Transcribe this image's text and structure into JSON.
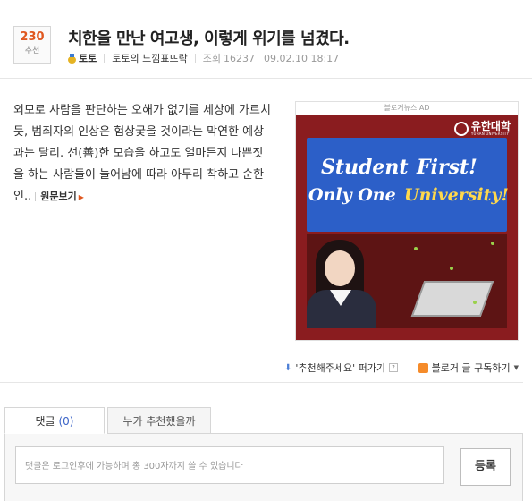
{
  "post": {
    "recommend_count": "230",
    "recommend_label": "추천",
    "title": "치한을 만난 여고생, 이렇게 위기를 넘겼다.",
    "author": "토토",
    "blog_name": "토토의 느낌표뜨락",
    "views_label": "조회",
    "views": "16237",
    "date": "09.02.10 18:17"
  },
  "content": {
    "summary": "외모로 사람을 판단하는 오해가 없기를 세상에 가르치듯, 범죄자의 인상은 험상궂을 것이라는 막연한 예상과는 달리. 선(善)한 모습을 하고도 얼마든지 나쁜짓을 하는 사람들이 늘어남에 따라 아무리 착하고 순한 인..",
    "more_label": "원문보기"
  },
  "ad": {
    "tag": "블로거뉴스 AD",
    "logo_name": "유한대학",
    "logo_sub": "YUHAN UNIVERSITY",
    "line1_left": "Student",
    "line1_right": "First!",
    "line2_left": "Only One",
    "line2_right": "University!",
    "bg_color": "#8a1c1f",
    "panel_color": "#2c5fc8"
  },
  "actions": {
    "recommend_label": "'추천해주세요' 퍼가기",
    "help_icon": "?",
    "subscribe_label": "블로거 글 구독하기"
  },
  "comments": {
    "tab_comments_label": "댓글",
    "tab_comments_count": "(0)",
    "tab_recommenders_label": "누가 추천했을까",
    "input_placeholder": "댓글은 로그인후에 가능하며 총 300자까지 쓸 수 있습니다",
    "submit_label": "등록"
  }
}
